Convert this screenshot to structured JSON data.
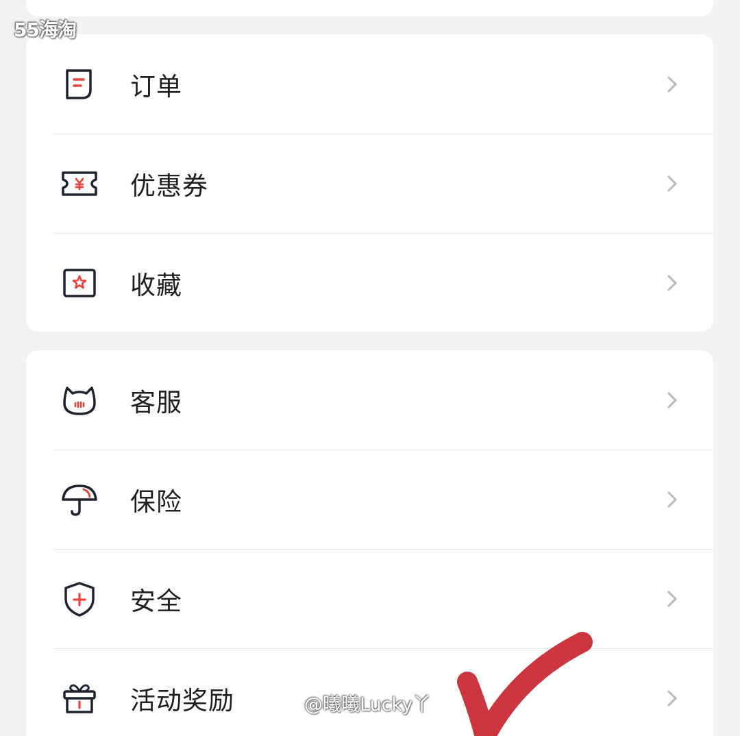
{
  "watermark": {
    "logo": "55海淘",
    "user": "@曦曦Lucky丫"
  },
  "accent_color": "#e8453c",
  "card1": {
    "items": [
      {
        "label": "订单",
        "icon": "order-doc-icon"
      },
      {
        "label": "优惠券",
        "icon": "coupon-ticket-icon"
      },
      {
        "label": "收藏",
        "icon": "favorite-star-icon"
      }
    ]
  },
  "card2": {
    "items": [
      {
        "label": "客服",
        "icon": "customer-service-cat-icon"
      },
      {
        "label": "保险",
        "icon": "insurance-umbrella-icon"
      },
      {
        "label": "安全",
        "icon": "security-shield-icon"
      },
      {
        "label": "活动奖励",
        "icon": "gift-icon"
      }
    ]
  }
}
